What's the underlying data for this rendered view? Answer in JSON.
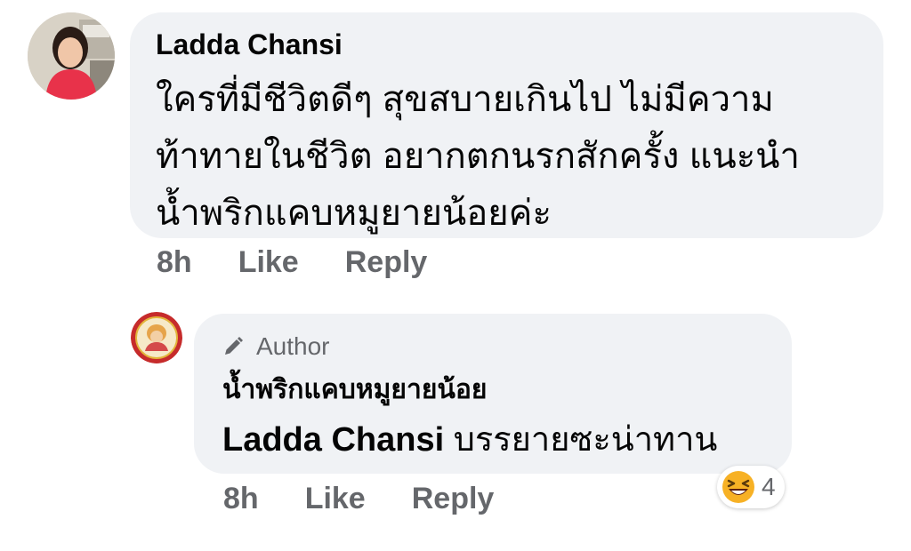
{
  "comment": {
    "author": "Ladda Chansi",
    "lines": [
      "ใครที่มีชีวิตดีๆ สุขสบายเกินไป ไม่มีความ",
      "ท้าทายในชีวิต อยากตกนรกสักครั้ง แนะนำ",
      "น้ำพริกแคบหมูยายน้อยค่ะ"
    ],
    "time": "8h",
    "like_label": "Like",
    "reply_label": "Reply"
  },
  "reply": {
    "badge": "Author",
    "page_name": "น้ำพริกแคบหมูยายน้อย",
    "mention": "Ladda Chansi",
    "text": "บรรยายซะน่าทาน",
    "time": "8h",
    "like_label": "Like",
    "reply_label": "Reply",
    "reaction": {
      "icon": "laughing-emoji-icon",
      "count": "4"
    }
  },
  "colors": {
    "bubble": "#f0f2f5",
    "meta_text": "#65676b",
    "primary_text": "#050505"
  }
}
